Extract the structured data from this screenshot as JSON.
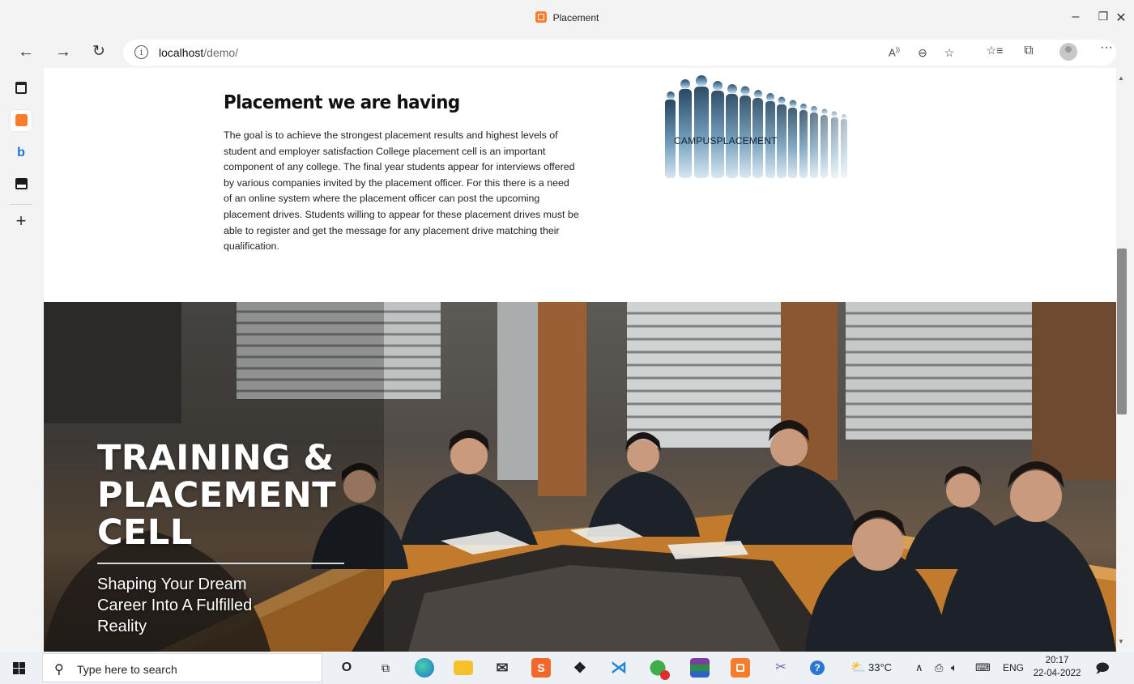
{
  "window": {
    "title": "Placement"
  },
  "toolbar": {
    "url_host": "localhost",
    "url_path": "/demo/"
  },
  "article": {
    "heading": "Placement we are having",
    "body": "The goal is to achieve the strongest placement results and highest levels of student and employer satisfaction College placement cell is an important component of any college. The final year students appear for interviews offered by various companies invited by the placement officer. For this there is a need of an online system where the placement officer can post the upcoming placement drives. Students willing to appear for these placement drives must be able to register and get the message for any placement drive matching their qualification."
  },
  "campus_image": {
    "label": "CAMPUSPLACEMENT"
  },
  "hero": {
    "title_line1": "TRAINING &",
    "title_line2": "PLACEMENT",
    "title_line3": "CELL",
    "subtitle": "Shaping Your Dream Career Into A Fulfilled Reality"
  },
  "taskbar": {
    "search_placeholder": "Type here to search",
    "weather": "33°C",
    "language": "ENG",
    "time": "20:17",
    "date": "22-04-2022"
  },
  "colors": {
    "accent_orange": "#f77d2a",
    "chrome_bg": "#f3f3f3",
    "taskbar_bg": "#edf1f6"
  }
}
